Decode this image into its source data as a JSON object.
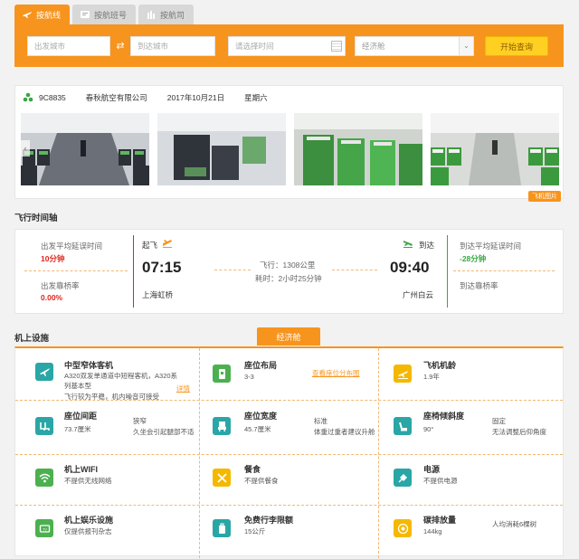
{
  "tabs": [
    {
      "label": "按航线",
      "active": true,
      "icon": "plane-icon"
    },
    {
      "label": "按航班号",
      "active": false,
      "icon": "flight-number-icon"
    },
    {
      "label": "按航司",
      "active": false,
      "icon": "airline-icon"
    }
  ],
  "search": {
    "from_placeholder": "出发城市",
    "to_placeholder": "到达城市",
    "date_placeholder": "请选择时间",
    "cabin_value": "经济舱",
    "submit_label": "开始查询"
  },
  "flight": {
    "number": "9C8835",
    "airline": "春秋航空有限公司",
    "date": "2017年10月21日",
    "weekday": "星期六",
    "photo_tag": "飞机图片"
  },
  "timeline": {
    "section_title": "飞行时间轴",
    "dep_delay_label": "出发平均延误时间",
    "dep_delay_value": "10分钟",
    "dep_bridge_label": "出发靠桥率",
    "dep_bridge_value": "0.00%",
    "dep_tag": "起飞",
    "dep_time": "07:15",
    "dep_airport": "上海虹桥",
    "distance": "飞行：1308公里",
    "duration": "耗时：2小时25分钟",
    "arr_tag": "到达",
    "arr_time": "09:40",
    "arr_airport": "广州白云",
    "arr_delay_label": "到达平均延误时间",
    "arr_delay_value": "-28分钟",
    "arr_bridge_label": "到达靠桥率"
  },
  "facilities": {
    "section_title": "机上设施",
    "cabin_tab": "经济舱",
    "items": [
      {
        "title": "中型窄体客机",
        "desc1": "A320双发单通道中短程客机，A320系列基本型",
        "desc2": "飞行较为平稳，机内噪音可接受",
        "link": "详情",
        "icon": "airplane-icon",
        "color": "#2aa6a6"
      },
      {
        "title": "座位布局",
        "desc1": "3-3",
        "link": "查看座位分布图",
        "icon": "seat-layout-icon",
        "color": "#4cb050"
      },
      {
        "title": "飞机机龄",
        "desc1": "1.9年",
        "icon": "plane-age-icon",
        "color": "#f5b800"
      },
      {
        "title": "座位间距",
        "desc1": "73.7厘米",
        "note1": "狭窄",
        "note2": "久坐会引起腿部不适",
        "icon": "seat-pitch-icon",
        "color": "#2aa6a6"
      },
      {
        "title": "座位宽度",
        "desc1": "45.7厘米",
        "note1": "标准",
        "note2": "体重过重者建议升舱",
        "icon": "seat-width-icon",
        "color": "#2aa6a6"
      },
      {
        "title": "座椅倾斜度",
        "desc1": "90°",
        "note1": "固定",
        "note2": "无法调整后仰角度",
        "icon": "seat-recline-icon",
        "color": "#2aa6a6"
      },
      {
        "title": "机上WIFI",
        "desc1": "不提供无线网络",
        "icon": "wifi-icon",
        "color": "#4cb050"
      },
      {
        "title": "餐食",
        "desc1": "不提供餐食",
        "icon": "meal-icon",
        "color": "#f5b800"
      },
      {
        "title": "电源",
        "desc1": "不提供电源",
        "icon": "power-plug-icon",
        "color": "#2aa6a6"
      },
      {
        "title": "机上娱乐设施",
        "desc1": "仅提供报刊杂志",
        "icon": "tv-icon",
        "color": "#4cb050"
      },
      {
        "title": "免费行李限额",
        "desc1": "15公斤",
        "icon": "luggage-icon",
        "color": "#2aa6a6"
      },
      {
        "title": "碳排放量",
        "desc1": "144kg",
        "note1": "人均消耗6棵树",
        "icon": "carbon-icon",
        "color": "#f5b800"
      }
    ]
  }
}
